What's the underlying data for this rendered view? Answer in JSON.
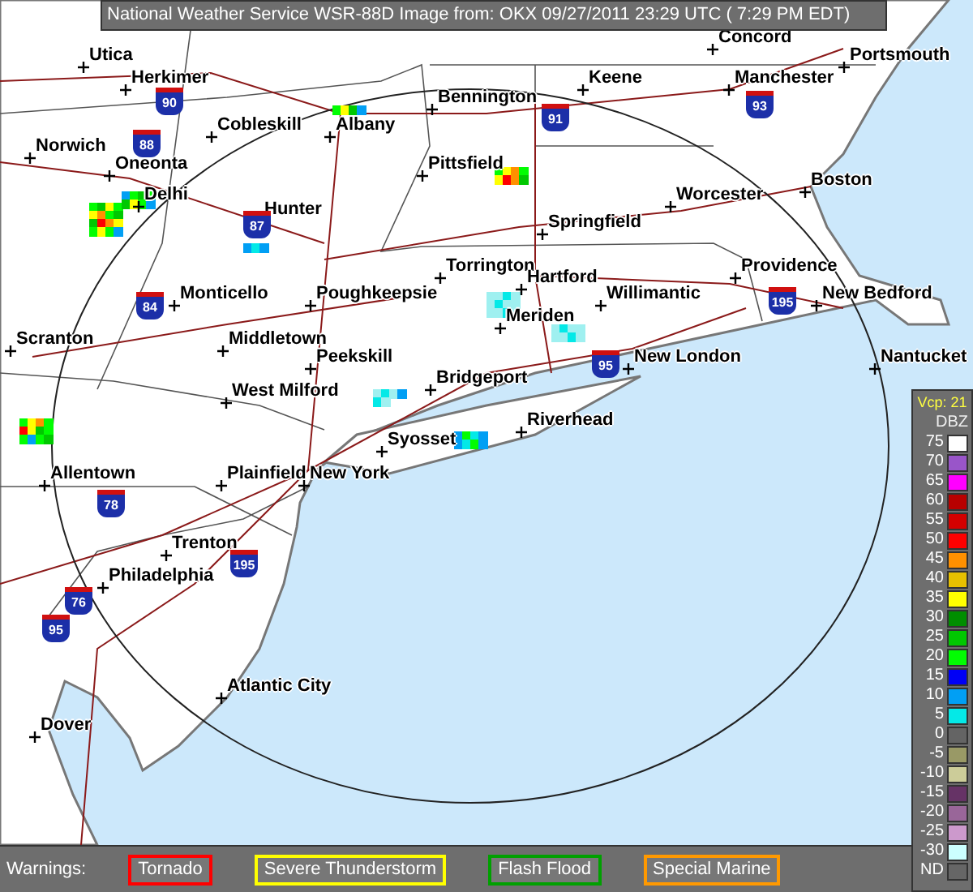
{
  "header": {
    "title": "National Weather Service WSR-88D Image from: OKX 09/27/2011 23:29 UTC ( 7:29 PM EDT)"
  },
  "cities": [
    {
      "name": "Concord"
    },
    {
      "name": "Utica"
    },
    {
      "name": "Portsmouth"
    },
    {
      "name": "Herkimer"
    },
    {
      "name": "Keene"
    },
    {
      "name": "Manchester"
    },
    {
      "name": "Bennington"
    },
    {
      "name": "Cobleskill"
    },
    {
      "name": "Albany"
    },
    {
      "name": "Norwich"
    },
    {
      "name": "Oneonta"
    },
    {
      "name": "Pittsfield"
    },
    {
      "name": "Boston"
    },
    {
      "name": "Delhi"
    },
    {
      "name": "Worcester"
    },
    {
      "name": "Hunter"
    },
    {
      "name": "Springfield"
    },
    {
      "name": "Torrington"
    },
    {
      "name": "Providence"
    },
    {
      "name": "Hartford"
    },
    {
      "name": "Monticello"
    },
    {
      "name": "Poughkeepsie"
    },
    {
      "name": "Willimantic"
    },
    {
      "name": "New Bedford"
    },
    {
      "name": "Meriden"
    },
    {
      "name": "Scranton"
    },
    {
      "name": "Middletown"
    },
    {
      "name": "Peekskill"
    },
    {
      "name": "New London"
    },
    {
      "name": "Nantucket"
    },
    {
      "name": "Bridgeport"
    },
    {
      "name": "West Milford"
    },
    {
      "name": "Riverhead"
    },
    {
      "name": "Syosset"
    },
    {
      "name": "Allentown"
    },
    {
      "name": "Plainfield"
    },
    {
      "name": "New York"
    },
    {
      "name": "Trenton"
    },
    {
      "name": "Philadelphia"
    },
    {
      "name": "Atlantic City"
    },
    {
      "name": "Dover"
    }
  ],
  "interstates": [
    {
      "number": "90"
    },
    {
      "number": "88"
    },
    {
      "number": "87"
    },
    {
      "number": "91"
    },
    {
      "number": "93"
    },
    {
      "number": "84"
    },
    {
      "number": "95"
    },
    {
      "number": "195"
    },
    {
      "number": "78"
    },
    {
      "number": "195"
    },
    {
      "number": "76"
    },
    {
      "number": "95"
    }
  ],
  "legend": {
    "vcp": "Vcp: 21",
    "unit": "DBZ",
    "entries": [
      {
        "label": "75",
        "color": "#ffffff"
      },
      {
        "label": "70",
        "color": "#9955c9"
      },
      {
        "label": "65",
        "color": "#ff00ff"
      },
      {
        "label": "60",
        "color": "#b80000"
      },
      {
        "label": "55",
        "color": "#d40000"
      },
      {
        "label": "50",
        "color": "#ff0000"
      },
      {
        "label": "45",
        "color": "#ff9000"
      },
      {
        "label": "40",
        "color": "#e7c000"
      },
      {
        "label": "35",
        "color": "#ffff00"
      },
      {
        "label": "30",
        "color": "#008e00"
      },
      {
        "label": "25",
        "color": "#01c801"
      },
      {
        "label": "20",
        "color": "#02fd02"
      },
      {
        "label": "15",
        "color": "#0000f6"
      },
      {
        "label": "10",
        "color": "#019ff4"
      },
      {
        "label": "5",
        "color": "#04e9e7"
      },
      {
        "label": "0",
        "color": "#646464"
      },
      {
        "label": "-5",
        "color": "#999966"
      },
      {
        "label": "-10",
        "color": "#cccc99"
      },
      {
        "label": "-15",
        "color": "#663366"
      },
      {
        "label": "-20",
        "color": "#996699"
      },
      {
        "label": "-25",
        "color": "#cc99cc"
      },
      {
        "label": "-30",
        "color": "#ccffff"
      },
      {
        "label": "ND",
        "color": "#666666"
      }
    ]
  },
  "warnings": {
    "label": "Warnings:",
    "items": [
      {
        "label": "Tornado",
        "color": "#ff0000"
      },
      {
        "label": "Severe Thunderstorm",
        "color": "#ffff00"
      },
      {
        "label": "Flash Flood",
        "color": "#00a000"
      },
      {
        "label": "Special Marine",
        "color": "#ff9900"
      }
    ]
  }
}
